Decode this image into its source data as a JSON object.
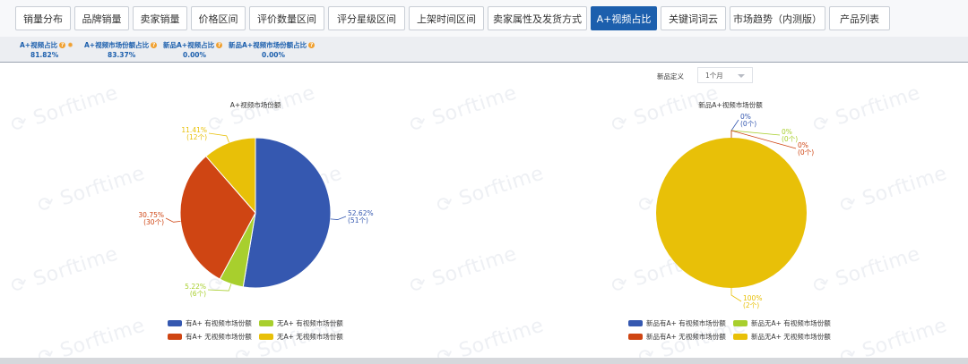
{
  "tabs": [
    {
      "label": "销量分布",
      "active": false
    },
    {
      "label": "品牌销量",
      "active": false
    },
    {
      "label": "卖家销量",
      "active": false
    },
    {
      "label": "价格区间",
      "active": false
    },
    {
      "label": "评价数量区间",
      "active": false
    },
    {
      "label": "评分星级区间",
      "active": false
    },
    {
      "label": "上架时间区间",
      "active": false
    },
    {
      "label": "卖家属性及发货方式",
      "active": false
    },
    {
      "label": "A+视频占比",
      "active": true
    },
    {
      "label": "关键词词云",
      "active": false
    },
    {
      "label": "市场趋势（内测版）",
      "active": false
    },
    {
      "label": "产品列表",
      "active": false
    }
  ],
  "metrics": [
    {
      "label": "A+视频占比",
      "value": "81.82%"
    },
    {
      "label": "A+视频市场份额占比",
      "value": "83.37%"
    },
    {
      "label": "新品A+视频占比",
      "value": "0.00%"
    },
    {
      "label": "新品A+视频市场份额占比",
      "value": "0.00%"
    }
  ],
  "filter": {
    "label": "新品定义",
    "value": "1个月"
  },
  "watermark": "Sorftime",
  "colors": {
    "blue": "#3558b0",
    "green": "#a8cf2d",
    "orange": "#cf4513",
    "yellow": "#e8c008",
    "brand": "#1c5fad"
  },
  "chart_data": [
    {
      "type": "pie",
      "title": "A+视频市场份额",
      "slices": [
        {
          "name": "有A+ 有视频市场份额",
          "value": 52.62,
          "label": "52.62%",
          "count": "(51个)",
          "color": "#3558b0"
        },
        {
          "name": "无A+ 有视频市场份额",
          "value": 5.22,
          "label": "5.22%",
          "count": "(6个)",
          "color": "#a8cf2d"
        },
        {
          "name": "有A+ 无视频市场份额",
          "value": 30.75,
          "label": "30.75%",
          "count": "(30个)",
          "color": "#cf4513"
        },
        {
          "name": "无A+ 无视频市场份额",
          "value": 11.41,
          "label": "11.41%",
          "count": "(12个)",
          "color": "#e8c008"
        }
      ]
    },
    {
      "type": "pie",
      "title": "新品A+视频市场份额",
      "slices": [
        {
          "name": "新品有A+ 有视频市场份额",
          "value": 0,
          "label": "0%",
          "count": "(0个)",
          "color": "#3558b0"
        },
        {
          "name": "新品无A+ 有视频市场份额",
          "value": 0,
          "label": "0%",
          "count": "(0个)",
          "color": "#a8cf2d"
        },
        {
          "name": "新品有A+ 无视频市场份额",
          "value": 0,
          "label": "0%",
          "count": "(0个)",
          "color": "#cf4513"
        },
        {
          "name": "新品无A+ 无视频市场份额",
          "value": 100,
          "label": "100%",
          "count": "(2个)",
          "color": "#e8c008"
        }
      ]
    }
  ]
}
